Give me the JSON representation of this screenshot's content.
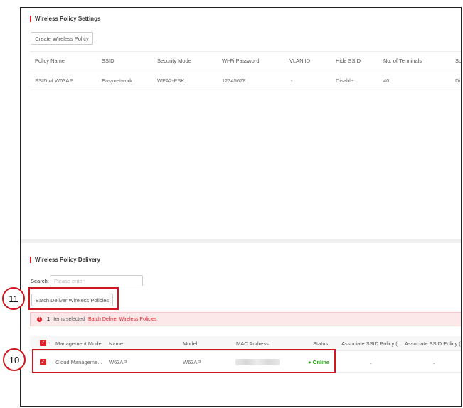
{
  "policy_settings": {
    "title": "Wireless Policy Settings",
    "create_button": "Create Wireless Policy",
    "columns": [
      "Policy Name",
      "SSID",
      "Security Mode",
      "Wi-Fi Password",
      "VLAN ID",
      "Hide SSID",
      "No. of Terminals",
      "So"
    ],
    "rows": [
      [
        "SSID of W63AP",
        "Easynetwork",
        "WPA2-PSK",
        "12345678",
        "-",
        "Disable",
        "40",
        "Di"
      ]
    ]
  },
  "policy_delivery": {
    "title": "Wireless Policy Delivery",
    "search_label": "Search:",
    "search_placeholder": "Please enter",
    "batch_button": "Batch Deliver Wireless Policies",
    "alert": {
      "icon": "!",
      "count": "1",
      "text": "Items selected",
      "link": "Batch Deliver Wireless Policies"
    },
    "columns": [
      "Management Mode",
      "Name",
      "Model",
      "MAC Address",
      "Status",
      "Associate SSID Policy (...",
      "Associate SSID Policy (..."
    ],
    "rows": [
      {
        "management_mode": "Cloud Manageme...",
        "name": "W63AP",
        "model": "W63AP",
        "status": "Online",
        "assoc1": "-",
        "assoc2": "-"
      }
    ]
  },
  "callouts": {
    "batch": "11",
    "row": "10"
  },
  "colors": {
    "accent": "#e0212b",
    "online": "#2aa81a",
    "callout": "#d0161e"
  }
}
